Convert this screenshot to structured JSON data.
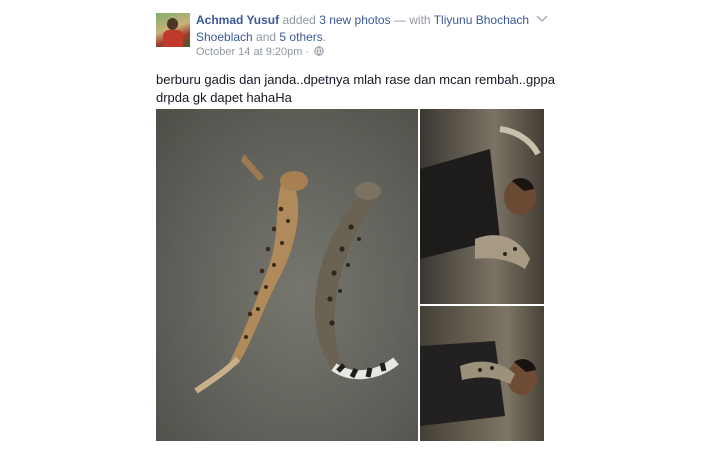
{
  "post": {
    "author": "Achmad Yusuf",
    "action_text": " added ",
    "photos_link": "3 new photos",
    "with_text": " — with ",
    "tagged_person": "Tliyunu Bhochach Shoeblach",
    "and_text": " and ",
    "others_link": "5 others",
    "period": ".",
    "timestamp": "October 14 at 9:20pm",
    "separator": " · ",
    "privacy_icon": "globe-icon",
    "options_icon": "chevron-down-icon",
    "status_text": "berburu gadis dan janda..dpetnya mlah rase dan mcan rembah..gppa drpda gk dapet hahaHa"
  },
  "photos": [
    {
      "alt": "main-photo"
    },
    {
      "alt": "top-right-photo"
    },
    {
      "alt": "bottom-right-photo"
    }
  ],
  "colors": {
    "link": "#3b5998",
    "meta": "#9197a3",
    "text": "#141823"
  }
}
